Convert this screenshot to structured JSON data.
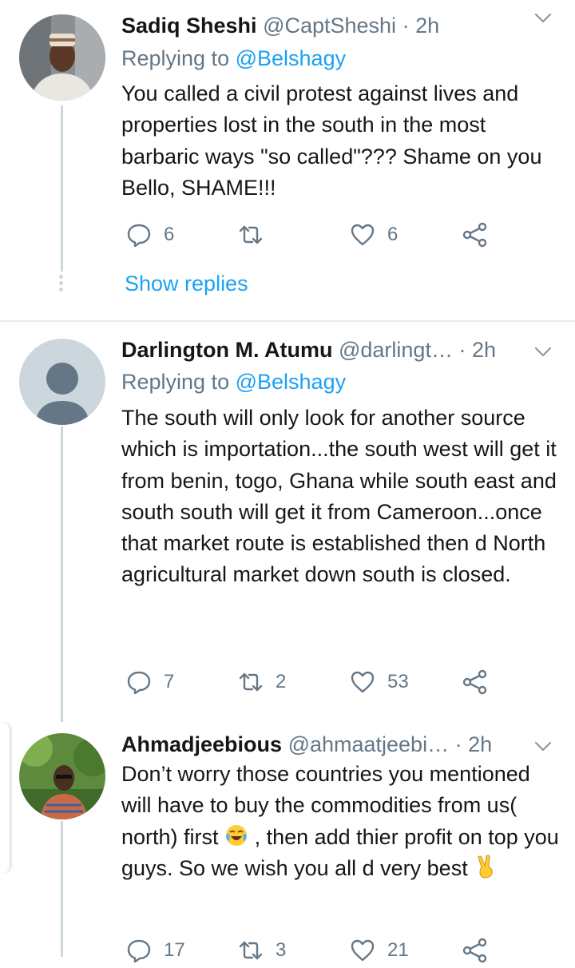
{
  "tweets": [
    {
      "name": "Sadiq Sheshi",
      "handle": "@CaptSheshi",
      "time": "· 2h",
      "replying_prefix": "Replying to",
      "replying_to": "@Belshagy",
      "text": "You called a civil protest against lives and properties lost in the south in the most barbaric ways \"so called\"??? Shame on you Bello, SHAME!!!",
      "replies": "6",
      "retweets": "",
      "likes": "6",
      "show_replies": "Show replies"
    },
    {
      "name": "Darlington M. Atumu",
      "handle": "@darlingt…",
      "time": "· 2h",
      "replying_prefix": "Replying to",
      "replying_to": "@Belshagy",
      "text": "The south will only look for another source which is importation...the south west will get it from benin, togo, Ghana while south east and south south will get it from Cameroon...once that market route is established then d North agricultural market down south is closed.",
      "replies": "7",
      "retweets": "2",
      "likes": "53"
    },
    {
      "name": "Ahmadjeebious",
      "handle": "@ahmaatjeebi…",
      "time": "· 2h",
      "text_1": "Don’t worry those countries you mentioned will have to buy the commodities from us( north) first",
      "text_2": ", then add thier profit on top you guys. So we wish you all d very best",
      "emoji_1": "face-with-tears-of-joy",
      "emoji_2": "victory-hand",
      "replies": "17",
      "retweets": "3",
      "likes": "21"
    }
  ],
  "colors": {
    "link": "#1da1f2",
    "secondary": "#657786",
    "text": "#14171a",
    "thread_line": "#ccd6dd"
  }
}
